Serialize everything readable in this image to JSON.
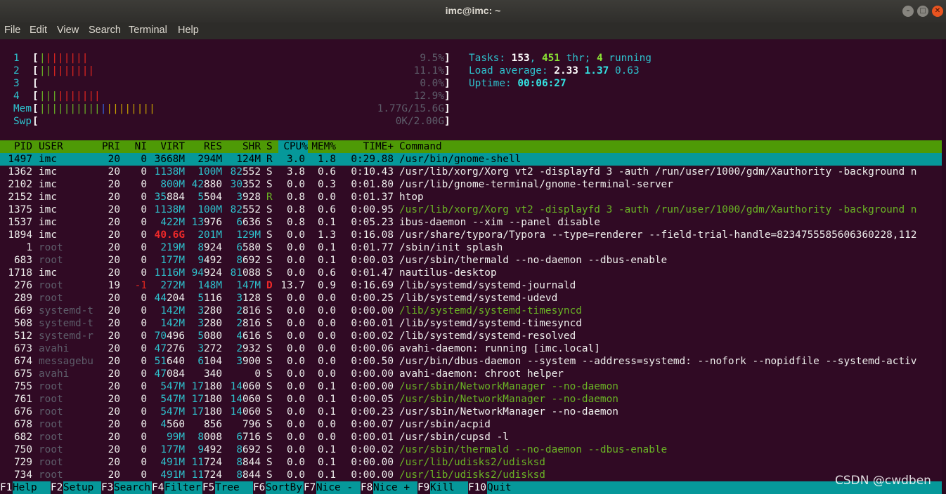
{
  "window": {
    "title": "imc@imc: ~"
  },
  "menu": [
    "File",
    "Edit",
    "View",
    "Search",
    "Terminal",
    "Help"
  ],
  "meters": {
    "cpus": [
      {
        "label": "1",
        "bar": "||||||||",
        "bar_colors": [
          "gr",
          "rd",
          "rd",
          "rd",
          "rd",
          "rd",
          "rd",
          "rd"
        ],
        "value": "9.5%"
      },
      {
        "label": "2",
        "bar": "|||||||||",
        "bar_colors": [
          "gr",
          "gr",
          "rd",
          "rd",
          "rd",
          "rd",
          "rd",
          "rd",
          "rd"
        ],
        "value": "11.1%"
      },
      {
        "label": "3",
        "bar": "",
        "bar_colors": [],
        "value": "0.0%"
      },
      {
        "label": "4",
        "bar": "||||||||||",
        "bar_colors": [
          "gr",
          "gr",
          "gr",
          "rd",
          "rd",
          "rd",
          "rd",
          "rd",
          "rd",
          "rd"
        ],
        "value": "12.9%"
      }
    ],
    "mem": {
      "label": "Mem",
      "bar": "|||||||||||||||||||",
      "bar_colors": [
        "gr",
        "gr",
        "gr",
        "gr",
        "gr",
        "gr",
        "gr",
        "gr",
        "gr",
        "gr",
        "bl",
        "yl",
        "yl",
        "yl",
        "yl",
        "yl",
        "yl",
        "yl",
        "yl"
      ],
      "value": "1.77G/15.6G"
    },
    "swp": {
      "label": "Swp",
      "bar": "",
      "value": "0K/2.00G"
    }
  },
  "summary": {
    "tasks_label": "Tasks: ",
    "tasks": "153",
    "sep1": ", ",
    "threads": "451",
    "thr_label": " thr; ",
    "running": "4",
    "running_label": " running",
    "load_label": "Load average: ",
    "load1": "2.33",
    "load5": "1.37",
    "load15": "0.63",
    "uptime_label": "Uptime: ",
    "uptime": "00:06:27"
  },
  "columns": [
    "PID",
    "USER",
    "PRI",
    "NI",
    "VIRT",
    "RES",
    "SHR",
    "S",
    "CPU%",
    "MEM%",
    "TIME+",
    "Command"
  ],
  "processes": [
    {
      "pid": "1497",
      "user": "imc",
      "pri": "20",
      "ni": "0",
      "virt": "3668M",
      "res": "294M",
      "shr": "124M",
      "s": "R",
      "cpu": "3.0",
      "mem": "1.8",
      "time": "0:29.88",
      "cmd": "/usr/bin/gnome-shell",
      "selected": true,
      "thread": false
    },
    {
      "pid": "1362",
      "user": "imc",
      "pri": "20",
      "ni": "0",
      "virt": "1138M",
      "res": "100M",
      "shr": "82552",
      "s": "S",
      "cpu": "3.8",
      "mem": "0.6",
      "time": "0:10.43",
      "cmd": "/usr/lib/xorg/Xorg vt2 -displayfd 3 -auth /run/user/1000/gdm/Xauthority -background n",
      "thread": false
    },
    {
      "pid": "2102",
      "user": "imc",
      "pri": "20",
      "ni": "0",
      "virt": "800M",
      "res": "42880",
      "shr": "30352",
      "s": "S",
      "cpu": "0.0",
      "mem": "0.3",
      "time": "0:01.80",
      "cmd": "/usr/lib/gnome-terminal/gnome-terminal-server",
      "thread": false
    },
    {
      "pid": "2152",
      "user": "imc",
      "pri": "20",
      "ni": "0",
      "virt": "35884",
      "res": "5504",
      "shr": "3928",
      "s": "R",
      "cpu": "0.8",
      "mem": "0.0",
      "time": "0:01.37",
      "cmd": "htop",
      "thread": false
    },
    {
      "pid": "1375",
      "user": "imc",
      "pri": "20",
      "ni": "0",
      "virt": "1138M",
      "res": "100M",
      "shr": "82552",
      "s": "S",
      "cpu": "0.8",
      "mem": "0.6",
      "time": "0:00.95",
      "cmd": "/usr/lib/xorg/Xorg vt2 -displayfd 3 -auth /run/user/1000/gdm/Xauthority -background n",
      "thread": true
    },
    {
      "pid": "1537",
      "user": "imc",
      "pri": "20",
      "ni": "0",
      "virt": "422M",
      "res": "13976",
      "shr": "6636",
      "s": "S",
      "cpu": "0.8",
      "mem": "0.1",
      "time": "0:05.23",
      "cmd": "ibus-daemon --xim --panel disable",
      "thread": false
    },
    {
      "pid": "1894",
      "user": "imc",
      "pri": "20",
      "ni": "0",
      "virt": "40.6G",
      "res": "201M",
      "shr": "129M",
      "s": "S",
      "cpu": "0.0",
      "mem": "1.3",
      "time": "0:16.08",
      "cmd": "/usr/share/typora/Typora --type=renderer --field-trial-handle=8234755585606360228,112",
      "thread": false,
      "virt_big": true
    },
    {
      "pid": "1",
      "user": "root",
      "pri": "20",
      "ni": "0",
      "virt": "219M",
      "res": "8924",
      "shr": "6580",
      "s": "S",
      "cpu": "0.0",
      "mem": "0.1",
      "time": "0:01.77",
      "cmd": "/sbin/init splash",
      "thread": false
    },
    {
      "pid": "683",
      "user": "root",
      "pri": "20",
      "ni": "0",
      "virt": "177M",
      "res": "9492",
      "shr": "8692",
      "s": "S",
      "cpu": "0.0",
      "mem": "0.1",
      "time": "0:00.03",
      "cmd": "/usr/sbin/thermald --no-daemon --dbus-enable",
      "thread": false
    },
    {
      "pid": "1718",
      "user": "imc",
      "pri": "20",
      "ni": "0",
      "virt": "1116M",
      "res": "94924",
      "shr": "81088",
      "s": "S",
      "cpu": "0.0",
      "mem": "0.6",
      "time": "0:01.47",
      "cmd": "nautilus-desktop",
      "thread": false
    },
    {
      "pid": "276",
      "user": "root",
      "pri": "19",
      "ni": "-1",
      "virt": "272M",
      "res": "148M",
      "shr": "147M",
      "s": "D",
      "cpu": "13.7",
      "mem": "0.9",
      "time": "0:16.69",
      "cmd": "/lib/systemd/systemd-journald",
      "thread": false
    },
    {
      "pid": "289",
      "user": "root",
      "pri": "20",
      "ni": "0",
      "virt": "44204",
      "res": "5116",
      "shr": "3128",
      "s": "S",
      "cpu": "0.0",
      "mem": "0.0",
      "time": "0:00.25",
      "cmd": "/lib/systemd/systemd-udevd",
      "thread": false
    },
    {
      "pid": "669",
      "user": "systemd-t",
      "pri": "20",
      "ni": "0",
      "virt": "142M",
      "res": "3280",
      "shr": "2816",
      "s": "S",
      "cpu": "0.0",
      "mem": "0.0",
      "time": "0:00.00",
      "cmd": "/lib/systemd/systemd-timesyncd",
      "thread": true
    },
    {
      "pid": "508",
      "user": "systemd-t",
      "pri": "20",
      "ni": "0",
      "virt": "142M",
      "res": "3280",
      "shr": "2816",
      "s": "S",
      "cpu": "0.0",
      "mem": "0.0",
      "time": "0:00.01",
      "cmd": "/lib/systemd/systemd-timesyncd",
      "thread": false
    },
    {
      "pid": "512",
      "user": "systemd-r",
      "pri": "20",
      "ni": "0",
      "virt": "70496",
      "res": "5080",
      "shr": "4616",
      "s": "S",
      "cpu": "0.0",
      "mem": "0.0",
      "time": "0:00.02",
      "cmd": "/lib/systemd/systemd-resolved",
      "thread": false
    },
    {
      "pid": "673",
      "user": "avahi",
      "pri": "20",
      "ni": "0",
      "virt": "47276",
      "res": "3272",
      "shr": "2932",
      "s": "S",
      "cpu": "0.0",
      "mem": "0.0",
      "time": "0:00.06",
      "cmd": "avahi-daemon: running [imc.local]",
      "thread": false
    },
    {
      "pid": "674",
      "user": "messagebu",
      "pri": "20",
      "ni": "0",
      "virt": "51640",
      "res": "6104",
      "shr": "3900",
      "s": "S",
      "cpu": "0.0",
      "mem": "0.0",
      "time": "0:00.50",
      "cmd": "/usr/bin/dbus-daemon --system --address=systemd: --nofork --nopidfile --systemd-activ",
      "thread": false
    },
    {
      "pid": "675",
      "user": "avahi",
      "pri": "20",
      "ni": "0",
      "virt": "47084",
      "res": "340",
      "shr": "0",
      "s": "S",
      "cpu": "0.0",
      "mem": "0.0",
      "time": "0:00.00",
      "cmd": "avahi-daemon: chroot helper",
      "thread": false
    },
    {
      "pid": "755",
      "user": "root",
      "pri": "20",
      "ni": "0",
      "virt": "547M",
      "res": "17180",
      "shr": "14060",
      "s": "S",
      "cpu": "0.0",
      "mem": "0.1",
      "time": "0:00.00",
      "cmd": "/usr/sbin/NetworkManager --no-daemon",
      "thread": true
    },
    {
      "pid": "761",
      "user": "root",
      "pri": "20",
      "ni": "0",
      "virt": "547M",
      "res": "17180",
      "shr": "14060",
      "s": "S",
      "cpu": "0.0",
      "mem": "0.1",
      "time": "0:00.05",
      "cmd": "/usr/sbin/NetworkManager --no-daemon",
      "thread": true
    },
    {
      "pid": "676",
      "user": "root",
      "pri": "20",
      "ni": "0",
      "virt": "547M",
      "res": "17180",
      "shr": "14060",
      "s": "S",
      "cpu": "0.0",
      "mem": "0.1",
      "time": "0:00.23",
      "cmd": "/usr/sbin/NetworkManager --no-daemon",
      "thread": false
    },
    {
      "pid": "678",
      "user": "root",
      "pri": "20",
      "ni": "0",
      "virt": "4560",
      "res": "856",
      "shr": "796",
      "s": "S",
      "cpu": "0.0",
      "mem": "0.0",
      "time": "0:00.07",
      "cmd": "/usr/sbin/acpid",
      "thread": false
    },
    {
      "pid": "682",
      "user": "root",
      "pri": "20",
      "ni": "0",
      "virt": "99M",
      "res": "8008",
      "shr": "6716",
      "s": "S",
      "cpu": "0.0",
      "mem": "0.0",
      "time": "0:00.01",
      "cmd": "/usr/sbin/cupsd -l",
      "thread": false
    },
    {
      "pid": "750",
      "user": "root",
      "pri": "20",
      "ni": "0",
      "virt": "177M",
      "res": "9492",
      "shr": "8692",
      "s": "S",
      "cpu": "0.0",
      "mem": "0.1",
      "time": "0:00.02",
      "cmd": "/usr/sbin/thermald --no-daemon --dbus-enable",
      "thread": true
    },
    {
      "pid": "729",
      "user": "root",
      "pri": "20",
      "ni": "0",
      "virt": "491M",
      "res": "11724",
      "shr": "8844",
      "s": "S",
      "cpu": "0.0",
      "mem": "0.1",
      "time": "0:00.00",
      "cmd": "/usr/lib/udisks2/udisksd",
      "thread": true
    },
    {
      "pid": "734",
      "user": "root",
      "pri": "20",
      "ni": "0",
      "virt": "491M",
      "res": "11724",
      "shr": "8844",
      "s": "S",
      "cpu": "0.0",
      "mem": "0.1",
      "time": "0:00.00",
      "cmd": "/usr/lib/udisks2/udisksd",
      "thread": true
    }
  ],
  "footer": [
    {
      "key": "F1",
      "label": "Help"
    },
    {
      "key": "F2",
      "label": "Setup"
    },
    {
      "key": "F3",
      "label": "Search"
    },
    {
      "key": "F4",
      "label": "Filter"
    },
    {
      "key": "F5",
      "label": "Tree"
    },
    {
      "key": "F6",
      "label": "SortBy"
    },
    {
      "key": "F7",
      "label": "Nice -"
    },
    {
      "key": "F8",
      "label": "Nice +"
    },
    {
      "key": "F9",
      "label": "Kill"
    },
    {
      "key": "F10",
      "label": "Quit"
    }
  ],
  "watermark": "CSDN @cwdben",
  "colors": {
    "background": "#300a24",
    "header": "#4e9a06",
    "selection": "#06989a",
    "close_button": "#e95420"
  }
}
